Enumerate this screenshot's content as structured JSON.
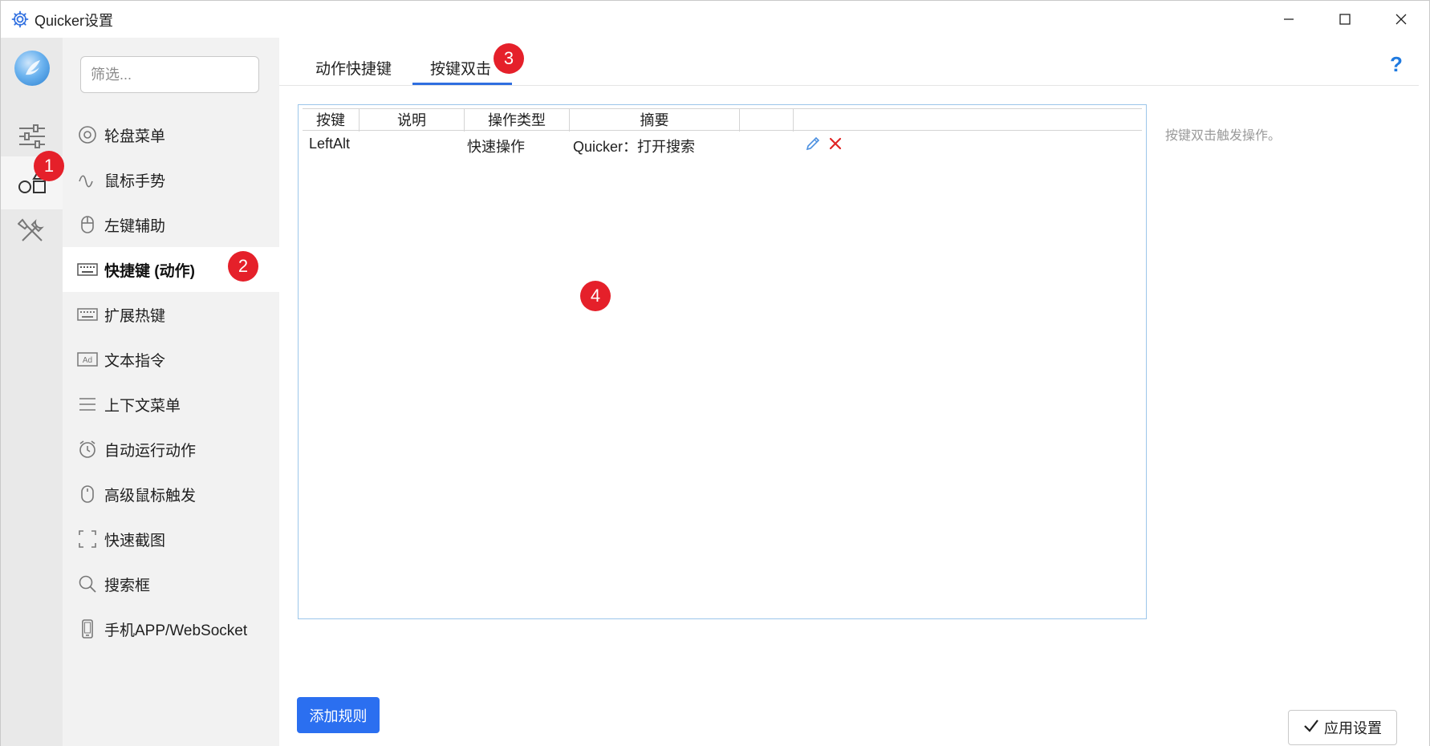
{
  "window": {
    "title": "Quicker设置"
  },
  "nav": {
    "search_placeholder": "筛选...",
    "items": [
      {
        "label": "轮盘菜单",
        "icon": "wheel-icon"
      },
      {
        "label": "鼠标手势",
        "icon": "gesture-icon"
      },
      {
        "label": "左键辅助",
        "icon": "mouse-icon"
      },
      {
        "label": "快捷键 (动作)",
        "icon": "keyboard-icon",
        "active": true
      },
      {
        "label": "扩展热键",
        "icon": "keyboard-icon"
      },
      {
        "label": "文本指令",
        "icon": "ad-icon"
      },
      {
        "label": "上下文菜单",
        "icon": "menu-icon"
      },
      {
        "label": "自动运行动作",
        "icon": "alarm-icon"
      },
      {
        "label": "高级鼠标触发",
        "icon": "mouse-icon"
      },
      {
        "label": "快速截图",
        "icon": "screenshot-icon"
      },
      {
        "label": "搜索框",
        "icon": "search-icon"
      },
      {
        "label": "手机APP/WebSocket",
        "icon": "phone-icon"
      }
    ]
  },
  "tabs": [
    {
      "label": "动作快捷键"
    },
    {
      "label": "按键双击",
      "active": true
    }
  ],
  "help_label": "?",
  "grid": {
    "columns": [
      "按键",
      "说明",
      "操作类型",
      "摘要"
    ],
    "rows": [
      {
        "key": "LeftAlt",
        "desc": "",
        "type": "快速操作",
        "summary": "Quicker：打开搜索"
      }
    ]
  },
  "side_hint": "按键双击触发操作。",
  "buttons": {
    "add_rule": "添加规则",
    "apply": "应用设置"
  },
  "markers": [
    "1",
    "2",
    "3",
    "4"
  ],
  "colors": {
    "accent": "#2b6ff0",
    "marker": "#e5202a",
    "delete": "#e02424"
  }
}
